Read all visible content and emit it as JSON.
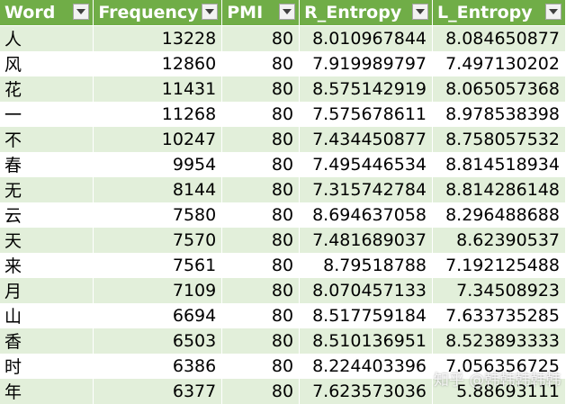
{
  "headers": [
    "Word",
    "Frequency",
    "PMI",
    "R_Entropy",
    "L_Entropy"
  ],
  "filter_icon": "chevron-down-icon",
  "colors": {
    "header_bg": "#70ad47",
    "band": "#e2efda",
    "header_text": "#ffffff"
  },
  "rows": [
    [
      "人",
      "13228",
      "80",
      "8.010967844",
      "8.084650877"
    ],
    [
      "风",
      "12860",
      "80",
      "7.919989797",
      "7.497130202"
    ],
    [
      "花",
      "11431",
      "80",
      "8.575142919",
      "8.065057368"
    ],
    [
      "一",
      "11268",
      "80",
      "7.575678611",
      "8.978538398"
    ],
    [
      "不",
      "10247",
      "80",
      "7.434450877",
      "8.758057532"
    ],
    [
      "春",
      "9954",
      "80",
      "7.495446534",
      "8.814518934"
    ],
    [
      "无",
      "8144",
      "80",
      "7.315742784",
      "8.814286148"
    ],
    [
      "云",
      "7580",
      "80",
      "8.694637058",
      "8.296488688"
    ],
    [
      "天",
      "7570",
      "80",
      "7.481689037",
      "8.62390537"
    ],
    [
      "来",
      "7561",
      "80",
      "8.79518788",
      "7.192125488"
    ],
    [
      "月",
      "7109",
      "80",
      "8.070457133",
      "7.34508923"
    ],
    [
      "山",
      "6694",
      "80",
      "8.517759184",
      "7.633735285"
    ],
    [
      "香",
      "6503",
      "80",
      "8.510136951",
      "8.523893333"
    ],
    [
      "时",
      "6386",
      "80",
      "8.224403396",
      "7.056356725"
    ],
    [
      "年",
      "6377",
      "80",
      "7.623573036",
      "5.88693111"
    ]
  ],
  "watermark": "知乎 @韩韩韩韩韩"
}
